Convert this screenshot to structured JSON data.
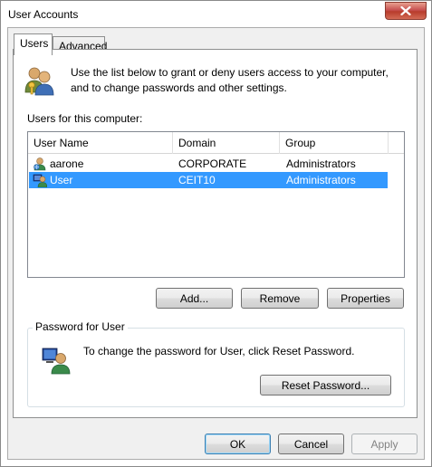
{
  "window": {
    "title": "User Accounts"
  },
  "tabs": [
    {
      "label": "Users",
      "active": true
    },
    {
      "label": "Advanced",
      "active": false
    }
  ],
  "users_tab": {
    "intro_text": "Use the list below to grant or deny users access to your computer, and to change passwords and other settings.",
    "list_label": "Users for this computer:",
    "columns": [
      "User Name",
      "Domain",
      "Group"
    ],
    "rows": [
      {
        "name": "aarone",
        "domain": "CORPORATE",
        "group": "Administrators",
        "icon": "domain-user-icon",
        "selected": false
      },
      {
        "name": "User",
        "domain": "CEIT10",
        "group": "Administrators",
        "icon": "local-user-icon",
        "selected": true
      }
    ],
    "buttons": {
      "add": "Add...",
      "remove": "Remove",
      "properties": "Properties"
    },
    "password_group": {
      "title": "Password for User",
      "text": "To change the password for User, click Reset Password.",
      "reset_button": "Reset Password..."
    }
  },
  "footer": {
    "ok": "OK",
    "cancel": "Cancel",
    "apply": "Apply"
  },
  "colors": {
    "selection": "#3399ff",
    "close_button": "#c75050",
    "default_button_border": "#3c7fb1"
  }
}
